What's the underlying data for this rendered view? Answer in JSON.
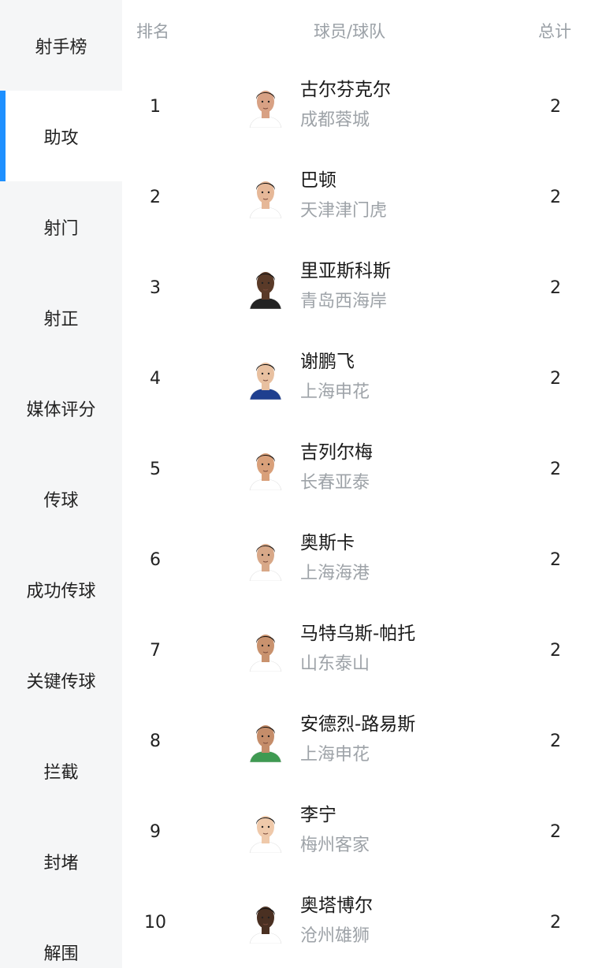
{
  "sidebar": {
    "items": [
      {
        "label": "射手榜"
      },
      {
        "label": "助攻",
        "active": true
      },
      {
        "label": "射门"
      },
      {
        "label": "射正"
      },
      {
        "label": "媒体评分"
      },
      {
        "label": "传球"
      },
      {
        "label": "成功传球"
      },
      {
        "label": "关键传球"
      },
      {
        "label": "拦截"
      },
      {
        "label": "封堵"
      },
      {
        "label": "解围"
      }
    ],
    "accent_color": "#1e90ff"
  },
  "table": {
    "headers": {
      "rank": "排名",
      "player": "球员/球队",
      "total": "总计"
    },
    "rows": [
      {
        "rank": "1",
        "name": "古尔芬克尔",
        "team": "成都蓉城",
        "total": "2",
        "skin": "#d8a184",
        "hair": "#2b2019",
        "shirt": "#ffffff"
      },
      {
        "rank": "2",
        "name": "巴顿",
        "team": "天津津门虎",
        "total": "2",
        "skin": "#e6b898",
        "hair": "#111111",
        "shirt": "#ffffff"
      },
      {
        "rank": "3",
        "name": "里亚斯科斯",
        "team": "青岛西海岸",
        "total": "2",
        "skin": "#5a3a28",
        "hair": "#111111",
        "shirt": "#222222"
      },
      {
        "rank": "4",
        "name": "谢鹏飞",
        "team": "上海申花",
        "total": "2",
        "skin": "#e8c0a0",
        "hair": "#111111",
        "shirt": "#1f3f8f"
      },
      {
        "rank": "5",
        "name": "吉列尔梅",
        "team": "长春亚泰",
        "total": "2",
        "skin": "#d9a07a",
        "hair": "#1b1512",
        "shirt": "#ffffff"
      },
      {
        "rank": "6",
        "name": "奥斯卡",
        "team": "上海海港",
        "total": "2",
        "skin": "#d8a888",
        "hair": "#2a2420",
        "shirt": "#ffffff"
      },
      {
        "rank": "7",
        "name": "马特乌斯-帕托",
        "team": "山东泰山",
        "total": "2",
        "skin": "#c9926e",
        "hair": "#1a1410",
        "shirt": "#ffffff"
      },
      {
        "rank": "8",
        "name": "安德烈-路易斯",
        "team": "上海申花",
        "total": "2",
        "skin": "#c58d6a",
        "hair": "#1a1410",
        "shirt": "#3f9a52"
      },
      {
        "rank": "9",
        "name": "李宁",
        "team": "梅州客家",
        "total": "2",
        "skin": "#efc9aa",
        "hair": "#1b1b1b",
        "shirt": "#ffffff"
      },
      {
        "rank": "10",
        "name": "奥塔博尔",
        "team": "沧州雄狮",
        "total": "2",
        "skin": "#4a3022",
        "hair": "#111111",
        "shirt": "#ffffff"
      }
    ]
  }
}
